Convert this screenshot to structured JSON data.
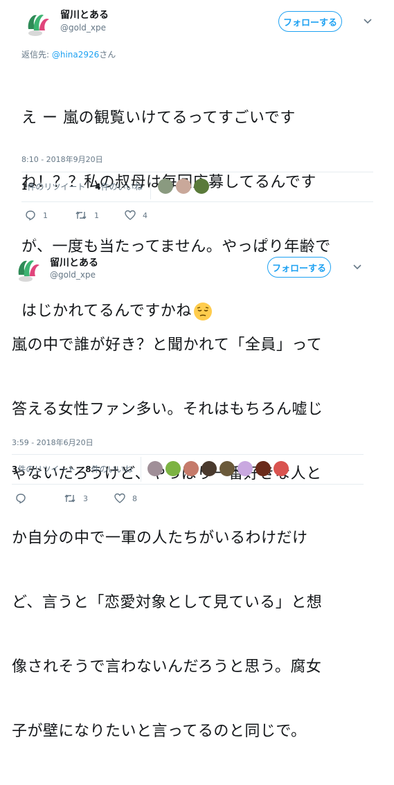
{
  "colors": {
    "accent": "#1da1f2",
    "muted": "#657786",
    "text": "#14171a",
    "divider": "#e6ecf0"
  },
  "tweets": [
    {
      "display_name": "留川とある",
      "handle": "@gold_xpe",
      "follow_label": "フォローする",
      "reply_to_prefix": "返信先: ",
      "reply_to_handle": "@hina2926",
      "reply_to_suffix": "さん",
      "body_lines": [
        "え ー 嵐の観覧いけてるってすごいです",
        "ね！？？私の叔母は毎回応募してるんです",
        "が、一度も当たってません。やっぱり年齢で",
        "はじかれてるんですかね"
      ],
      "emoji": "pensive-face",
      "timestamp": "8:10 - 2018年9月20日",
      "retweet_count": "1",
      "retweet_label": "件のリツイート",
      "like_count": "4",
      "like_label": "件のいいね",
      "liker_avatars": [
        "#8a9a80",
        "#c9a89a",
        "#5a7a3a"
      ],
      "action_reply_count": "1",
      "action_retweet_count": "1",
      "action_like_count": "4"
    },
    {
      "display_name": "留川とある",
      "handle": "@gold_xpe",
      "follow_label": "フォローする",
      "body_lines": [
        "嵐の中で誰が好き？と聞かれて「全員」って",
        "答える女性ファン多い。それはもちろん嘘じ",
        "ゃないだろうけど、やっぱり一番好きな人と",
        "か自分の中で一軍の人たちがいるわけだけ",
        "ど、言うと「恋愛対象として見ている」と想",
        "像されそうで言わないんだろうと思う。腐女",
        "子が壁になりたいと言ってるのと同じで。"
      ],
      "timestamp": "3:59 - 2018年6月20日",
      "retweet_count": "3",
      "retweet_label": "件のリツイート",
      "like_count": "8",
      "like_label": "件のいいね",
      "liker_avatars": [
        "#a08f98",
        "#7cb342",
        "#c57a6a",
        "#4a3a2e",
        "#6b5a3a",
        "#c9a8e0",
        "#6a2a1a",
        "#d9534f"
      ],
      "action_reply_count": "",
      "action_retweet_count": "3",
      "action_like_count": "8"
    }
  ]
}
